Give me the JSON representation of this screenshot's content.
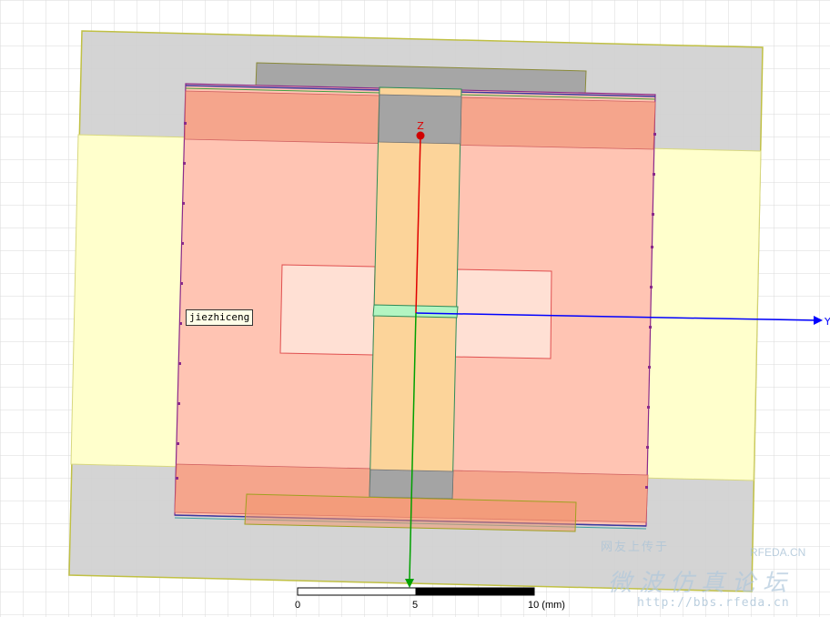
{
  "model": {
    "object_label": "jiezhiceng",
    "axis_z_label": "Z",
    "axis_y_label": "Y"
  },
  "scale_bar": {
    "tick_start": "0",
    "tick_mid": "5",
    "tick_end": "10 (mm)"
  },
  "watermark": {
    "line1": "网友上传于",
    "brand": "RFEDA.CN",
    "title": "微波仿真论坛",
    "url": "http://bbs.rfeda.cn"
  },
  "colors": {
    "grid": "#d8d8d8",
    "ground_gray": "#d2d2d2",
    "yellow_substrate": "#ffffcc",
    "salmon_patch": "#ffc4b3",
    "dark_salmon_band": "#f5a58c",
    "feed_strip": "#fcd49a",
    "slot_light": "#ffe0d4",
    "green_gap": "#b3f5c2",
    "axis_red": "#e00000",
    "axis_blue": "#0000ff",
    "axis_green": "#00a000"
  }
}
